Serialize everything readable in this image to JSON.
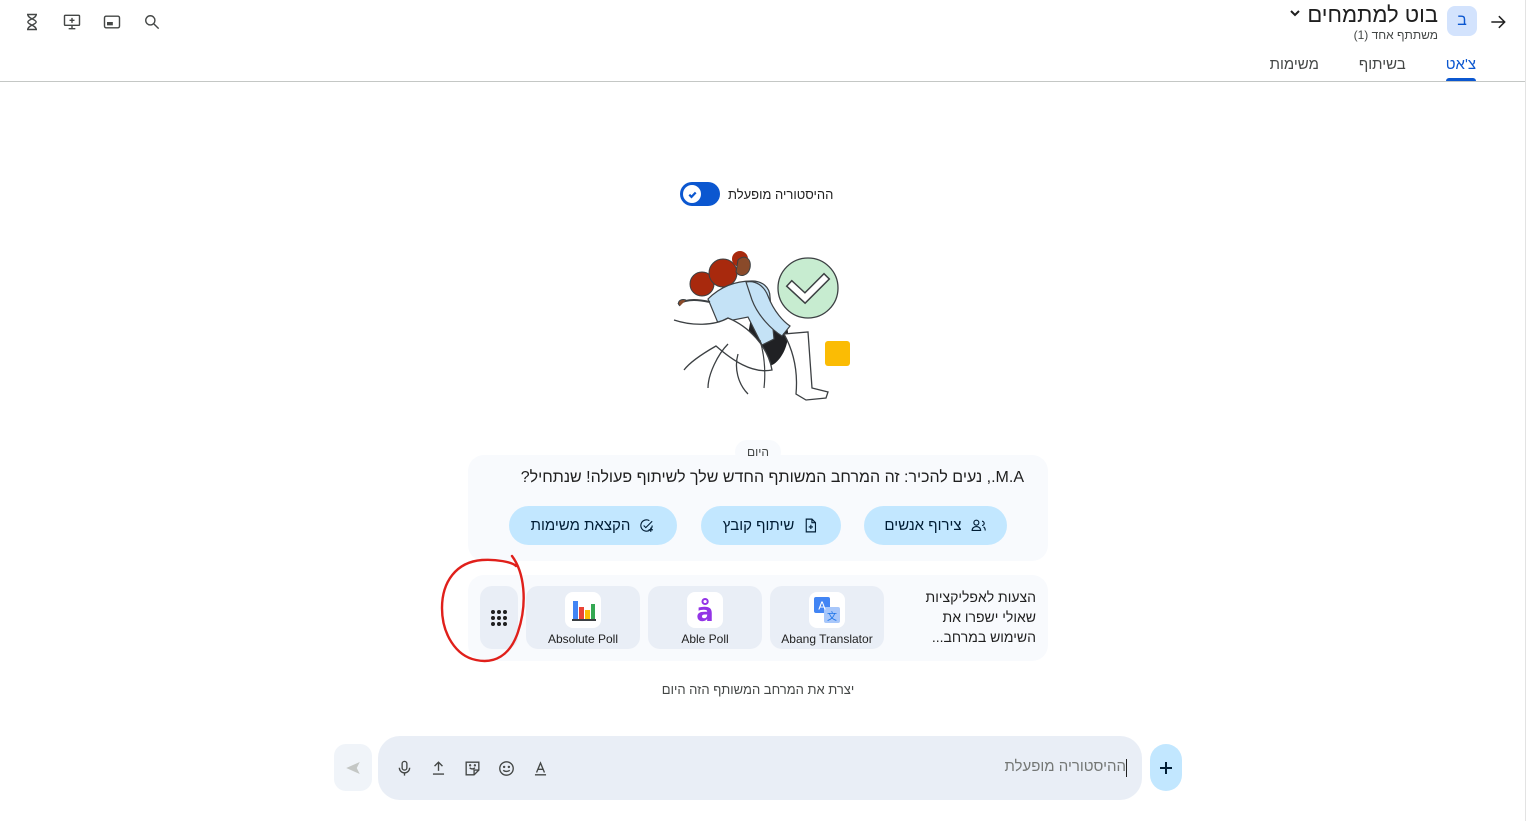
{
  "header": {
    "title": "בוט למתמחים",
    "avatar_letter": "ב",
    "subtitle": "משתתף אחד (1)"
  },
  "tabs": [
    {
      "label": "צ'אט",
      "active": true
    },
    {
      "label": "בשיתוף",
      "active": false
    },
    {
      "label": "משימות",
      "active": false
    }
  ],
  "history": {
    "label": "ההיסטוריה מופעלת",
    "enabled": true
  },
  "welcome": {
    "date_label": "היום",
    "message": "M.A., נעים להכיר: זה המרחב המשותף החדש שלך לשיתוף פעולה! שנתחיל?",
    "chips": [
      {
        "label": "צירוף אנשים",
        "icon": "add-people-icon"
      },
      {
        "label": "שיתוף קובץ",
        "icon": "file-share-icon"
      },
      {
        "label": "הקצאת משימות",
        "icon": "task-add-icon"
      }
    ]
  },
  "apps": {
    "suggestion_text": "הצעות לאפליקציות שאולי ישפרו את השימוש במרחב...",
    "items": [
      {
        "name": "Abang Translator",
        "icon": "translate-icon"
      },
      {
        "name": "Able Poll",
        "icon": "able-poll-icon"
      },
      {
        "name": "Absolute Poll",
        "icon": "bar-chart-icon"
      }
    ]
  },
  "created_note": "יצרת את המרחב המשותף הזה היום",
  "composer": {
    "placeholder": "ההיסטוריה מופעלת"
  },
  "colors": {
    "accent": "#0b57d0",
    "chip": "#c2e7ff",
    "surface": "#f8fafd",
    "annotation": "#e0201b"
  }
}
